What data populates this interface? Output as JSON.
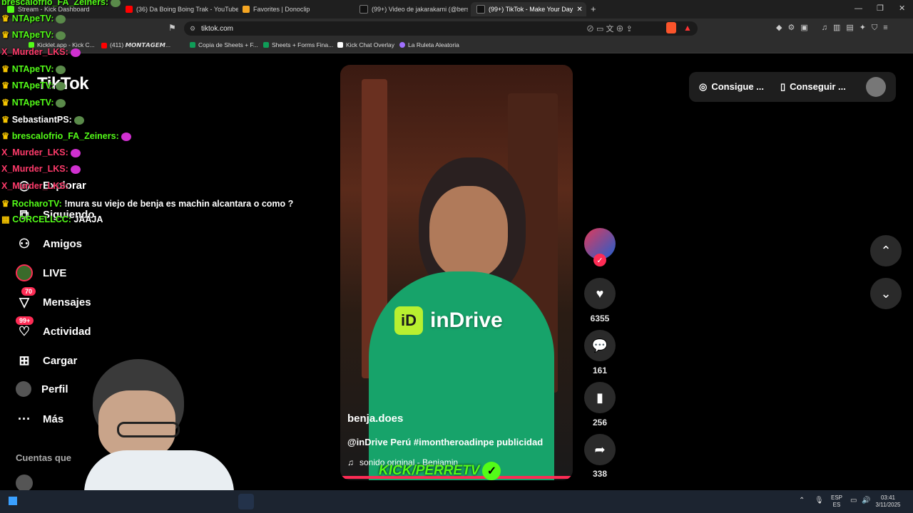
{
  "browser": {
    "tabs": [
      {
        "label": "Stream - Kick Dashboard",
        "color": "#53fc18"
      },
      {
        "label": "(36) Da Boing Boing Trak - YouTube",
        "color": "#ff0000"
      },
      {
        "label": "Favorites | Donoclip",
        "color": "#f5a623"
      },
      {
        "label": "(99+) Video de jakarakami (@berseri",
        "color": "#ffffff"
      },
      {
        "label": "(99+) TikTok - Make Your Day",
        "color": "#ffffff"
      }
    ],
    "url": "tiktok.com",
    "bookmarks": [
      {
        "label": "Kicklet.app - Kick C...",
        "color": "#53fc18"
      },
      {
        "label": "(411) 𝙈𝙊𝙉𝙏𝘼𝙂𝙀𝙈...",
        "color": "#ff0000"
      },
      {
        "label": "Copia de Sheets + F...",
        "color": "#0f9d58"
      },
      {
        "label": "Sheets + Forms Fina...",
        "color": "#0f9d58"
      },
      {
        "label": "Kick Chat Overlay",
        "color": "#ffffff"
      },
      {
        "label": "La Ruleta Aleatoria",
        "color": "#a070ff"
      }
    ]
  },
  "tiktok": {
    "logo": "TikTok",
    "nav": [
      {
        "label": "Explorar",
        "icon": "compass-icon"
      },
      {
        "label": "Siguiendo",
        "icon": "following-icon"
      },
      {
        "label": "Amigos",
        "icon": "friends-icon"
      },
      {
        "label": "LIVE",
        "icon": "live-icon"
      },
      {
        "label": "Mensajes",
        "icon": "inbox-icon",
        "badge": "70"
      },
      {
        "label": "Actividad",
        "icon": "activity-icon",
        "badge": "99+"
      },
      {
        "label": "Cargar",
        "icon": "upload-icon"
      },
      {
        "label": "Perfil",
        "icon": "profile-icon"
      },
      {
        "label": "Más",
        "icon": "more-icon"
      }
    ],
    "following_heading": "Cuentas que",
    "video": {
      "author": "benja.does",
      "caption": "@inDrive Perú #imontheroadinpe publicidad",
      "sound": "sonido original - Benjamin",
      "brand": "inDrive"
    },
    "actions": {
      "likes": "6355",
      "comments": "161",
      "saves": "256",
      "shares": "338"
    },
    "top_buttons": [
      "Consigue ...",
      "Conseguir ..."
    ]
  },
  "stream_overlay": {
    "watermark": "KICK/PERRETV",
    "chat": [
      {
        "user": "brescalofrio_FA_Zeiners:",
        "msg": "",
        "color": "#53fc18"
      },
      {
        "user": "NTApeTV:",
        "msg": "",
        "color": "#53fc18"
      },
      {
        "user": "NTApeTV:",
        "msg": "",
        "color": "#53fc18"
      },
      {
        "user": "X_Murder_LKS:",
        "msg": "",
        "color": "#ff3b6b"
      },
      {
        "user": "NTApeTV:",
        "msg": "",
        "color": "#53fc18"
      },
      {
        "user": "NTApeTV:",
        "msg": "",
        "color": "#53fc18"
      },
      {
        "user": "NTApeTV:",
        "msg": "",
        "color": "#53fc18"
      },
      {
        "user": "SebastiantPS:",
        "msg": "",
        "color": "#ffffff"
      },
      {
        "user": "brescalofrio_FA_Zeiners:",
        "msg": "",
        "color": "#53fc18"
      },
      {
        "user": "X_Murder_LKS:",
        "msg": "",
        "color": "#ff3b6b"
      },
      {
        "user": "X_Murder_LKS:",
        "msg": "",
        "color": "#ff3b6b"
      },
      {
        "user": "X_Murder_LKS:",
        "msg": "",
        "color": "#ff3b6b"
      },
      {
        "user": "RocharoTV:",
        "msg": "!mura su viejo de benja es machin alcantara o como ?",
        "color": "#53fc18"
      },
      {
        "user": "CORCELLCC:",
        "msg": "JAAJA",
        "color": "#53fc18"
      }
    ]
  },
  "taskbar": {
    "lang_top": "ESP",
    "lang_bottom": "ES",
    "time": "03:41",
    "date": "3/11/2025"
  }
}
